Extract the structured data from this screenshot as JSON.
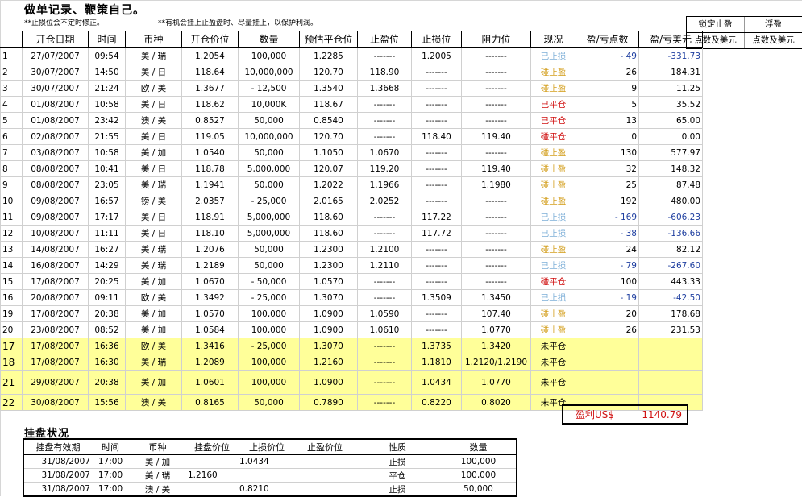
{
  "title": "做单记录、鞭策自己。",
  "notes": [
    "**止损位会不定时修正。",
    "**有机会挂上止盈盘时、尽量挂上，以保护利润。"
  ],
  "headers": [
    "开仓日期",
    "时间",
    "币种",
    "开仓价位",
    "数量",
    "预估平仓位",
    "止盈位",
    "止损位",
    "阻力位",
    "现况",
    "盈/亏点数",
    "盈/亏美元"
  ],
  "side_headers": [
    [
      "锁定止盈",
      "浮盈"
    ],
    [
      "点数及美元",
      "点数及美元"
    ]
  ],
  "rows": [
    {
      "n": "1",
      "date": "27/07/2007",
      "time": "09:54",
      "pair": "美 / 瑞",
      "open": "1.2054",
      "qty": "100,000",
      "est": "1.2285",
      "tp": "-------",
      "sl": "1.2005",
      "res": "-------",
      "status": "已止损",
      "st": "stop",
      "pts": "- 49",
      "usd": "-331.73",
      "neg": true
    },
    {
      "n": "2",
      "date": "30/07/2007",
      "time": "14:50",
      "pair": "美 / 日",
      "open": "118.64",
      "qty": "10,000,000",
      "est": "120.70",
      "tp": "118.90",
      "sl": "-------",
      "res": "-------",
      "status": "碰止盈",
      "st": "take",
      "pts": "26",
      "usd": "184.31"
    },
    {
      "n": "3",
      "date": "30/07/2007",
      "time": "21:24",
      "pair": "欧 / 美",
      "open": "1.3677",
      "qty": "- 12,500",
      "est": "1.3540",
      "tp": "1.3668",
      "sl": "-------",
      "res": "-------",
      "status": "碰止盈",
      "st": "take",
      "pts": "9",
      "usd": "11.25"
    },
    {
      "n": "4",
      "date": "01/08/2007",
      "time": "10:58",
      "pair": "美 / 日",
      "open": "118.62",
      "qty": "10,000K",
      "est": "118.67",
      "tp": "-------",
      "sl": "-------",
      "res": "-------",
      "status": "已平仓",
      "st": "close",
      "pts": "5",
      "usd": "35.52"
    },
    {
      "n": "5",
      "date": "01/08/2007",
      "time": "23:42",
      "pair": "澳 / 美",
      "open": "0.8527",
      "qty": "50,000",
      "est": "0.8540",
      "tp": "-------",
      "sl": "-------",
      "res": "-------",
      "status": "已平仓",
      "st": "close",
      "pts": "13",
      "usd": "65.00"
    },
    {
      "n": "6",
      "date": "02/08/2007",
      "time": "21:55",
      "pair": "美 / 日",
      "open": "119.05",
      "qty": "10,000,000",
      "est": "120.70",
      "tp": "-------",
      "sl": "118.40",
      "res": "119.40",
      "status": "碰平仓",
      "st": "close",
      "pts": "0",
      "usd": "0.00"
    },
    {
      "n": "7",
      "date": "03/08/2007",
      "time": "10:58",
      "pair": "美 / 加",
      "open": "1.0540",
      "qty": "50,000",
      "est": "1.1050",
      "tp": "1.0670",
      "sl": "-------",
      "res": "-------",
      "status": "碰止盈",
      "st": "take",
      "pts": "130",
      "usd": "577.97"
    },
    {
      "n": "8",
      "date": "08/08/2007",
      "time": "10:41",
      "pair": "美 / 日",
      "open": "118.78",
      "qty": "5,000,000",
      "est": "120.07",
      "tp": "119.20",
      "sl": "-------",
      "res": "119.40",
      "status": "碰止盈",
      "st": "take",
      "pts": "32",
      "usd": "148.32"
    },
    {
      "n": "9",
      "date": "08/08/2007",
      "time": "23:05",
      "pair": "美 / 瑞",
      "open": "1.1941",
      "qty": "50,000",
      "est": "1.2022",
      "tp": "1.1966",
      "sl": "-------",
      "res": "1.1980",
      "status": "碰止盈",
      "st": "take",
      "pts": "25",
      "usd": "87.48"
    },
    {
      "n": "10",
      "date": "09/08/2007",
      "time": "16:57",
      "pair": "镑 / 美",
      "open": "2.0357",
      "qty": "- 25,000",
      "est": "2.0165",
      "tp": "2.0252",
      "sl": "-------",
      "res": "-------",
      "status": "碰止盈",
      "st": "take",
      "pts": "192",
      "usd": "480.00"
    },
    {
      "n": "11",
      "date": "09/08/2007",
      "time": "17:17",
      "pair": "美 / 日",
      "open": "118.91",
      "qty": "5,000,000",
      "est": "118.60",
      "tp": "-------",
      "sl": "117.22",
      "res": "-------",
      "status": "已止损",
      "st": "stop",
      "pts": "- 169",
      "usd": "-606.23",
      "neg": true
    },
    {
      "n": "12",
      "date": "10/08/2007",
      "time": "11:11",
      "pair": "美 / 日",
      "open": "118.10",
      "qty": "5,000,000",
      "est": "118.60",
      "tp": "-------",
      "sl": "117.72",
      "res": "-------",
      "status": "已止损",
      "st": "stop",
      "pts": "- 38",
      "usd": "-136.66",
      "neg": true
    },
    {
      "n": "13",
      "date": "14/08/2007",
      "time": "16:27",
      "pair": "美 / 瑞",
      "open": "1.2076",
      "qty": "50,000",
      "est": "1.2300",
      "tp": "1.2100",
      "sl": "-------",
      "res": "-------",
      "status": "碰止盈",
      "st": "take",
      "pts": "24",
      "usd": "82.12"
    },
    {
      "n": "14",
      "date": "16/08/2007",
      "time": "14:29",
      "pair": "美 / 瑞",
      "open": "1.2189",
      "qty": "50,000",
      "est": "1.2300",
      "tp": "1.2110",
      "sl": "-------",
      "res": "-------",
      "status": "已止损",
      "st": "stop",
      "pts": "- 79",
      "usd": "-267.60",
      "neg": true
    },
    {
      "n": "15",
      "date": "17/08/2007",
      "time": "20:25",
      "pair": "美 / 加",
      "open": "1.0670",
      "qty": "- 50,000",
      "est": "1.0570",
      "tp": "-------",
      "sl": "-------",
      "res": "-------",
      "status": "碰平仓",
      "st": "close",
      "pts": "100",
      "usd": "443.33"
    },
    {
      "n": "16",
      "date": "20/08/2007",
      "time": "09:11",
      "pair": "欧 / 美",
      "open": "1.3492",
      "qty": "- 25,000",
      "est": "1.3070",
      "tp": "-------",
      "sl": "1.3509",
      "res": "1.3450",
      "status": "已止损",
      "st": "stop",
      "pts": "- 19",
      "usd": "-42.50",
      "neg": true
    },
    {
      "n": "19",
      "date": "17/08/2007",
      "time": "20:38",
      "pair": "美 / 加",
      "open": "1.0570",
      "qty": "100,000",
      "est": "1.0900",
      "tp": "1.0590",
      "sl": "-------",
      "res": "107.40",
      "status": "碰止盈",
      "st": "take",
      "pts": "20",
      "usd": "178.68"
    },
    {
      "n": "20",
      "date": "23/08/2007",
      "time": "08:52",
      "pair": "美 / 加",
      "open": "1.0584",
      "qty": "100,000",
      "est": "1.0900",
      "tp": "1.0610",
      "sl": "-------",
      "res": "1.0770",
      "status": "碰止盈",
      "st": "take",
      "pts": "26",
      "usd": "231.53"
    },
    {
      "n": "17",
      "date": "17/08/2007",
      "time": "16:36",
      "pair": "欧 / 美",
      "open": "1.3416",
      "qty": "- 25,000",
      "est": "1.3070",
      "tp": "-------",
      "sl": "1.3735",
      "res": "1.3420",
      "status": "未平仓",
      "st": "open",
      "pts": "",
      "usd": "",
      "y": true
    },
    {
      "n": "18",
      "date": "17/08/2007",
      "time": "16:30",
      "pair": "美 / 瑞",
      "open": "1.2089",
      "qty": "100,000",
      "est": "1.2160",
      "tp": "-------",
      "sl": "1.1810",
      "res": "1.2120/1.2190",
      "status": "未平仓",
      "st": "open",
      "pts": "",
      "usd": "",
      "y": true
    },
    {
      "n": "21",
      "date": "29/08/2007",
      "time": "20:38",
      "pair": "美 / 加",
      "open": "1.0601",
      "qty": "100,000",
      "est": "1.0900",
      "tp": "-------",
      "sl": "1.0434",
      "res": "1.0770",
      "status": "未平仓",
      "st": "open",
      "pts": "",
      "usd": "",
      "y": true,
      "tall": true
    },
    {
      "n": "22",
      "date": "30/08/2007",
      "time": "15:56",
      "pair": "澳 / 美",
      "open": "0.8165",
      "qty": "50,000",
      "est": "0.7890",
      "tp": "-------",
      "sl": "0.8220",
      "res": "0.8020",
      "status": "未平仓",
      "st": "open",
      "pts": "",
      "usd": "",
      "y": true
    }
  ],
  "profit": {
    "label": "盈利US$",
    "value": "1140.79"
  },
  "pending": {
    "title": "挂盘状况",
    "headers": [
      "挂盘有效期",
      "时间",
      "币种",
      "挂盘价位",
      "止损价位",
      "止盈价位",
      "性质",
      "数量"
    ],
    "rows": [
      [
        "31/08/2007",
        "17:00",
        "美 / 加",
        "",
        "1.0434",
        "",
        "止损",
        "100,000"
      ],
      [
        "31/08/2007",
        "17:00",
        "美 / 瑞",
        "1.2160",
        "",
        "",
        "平仓",
        "100,000"
      ],
      [
        "31/08/2007",
        "17:00",
        "澳 / 美",
        "",
        "0.8210",
        "",
        "止损",
        "50,000"
      ]
    ]
  },
  "colors": {
    "stop": "#7fb0d8",
    "take": "#d4a020",
    "close": "#d01010",
    "open": "#000000",
    "negative": "#1f3fa0",
    "open_row_bg": "#ffff99"
  }
}
